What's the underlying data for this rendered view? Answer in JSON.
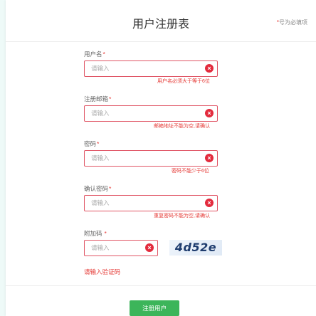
{
  "header": {
    "title": "用户注册表",
    "hint_star": "*",
    "hint": "号为必填项"
  },
  "fields": [
    {
      "label": "用户名",
      "star": "*",
      "placeholder": "请输入",
      "error": "用户名必须大于等于6位"
    },
    {
      "label": "注册邮箱",
      "star": "*",
      "placeholder": "请输入",
      "error": "邮箱地址不能为空,请确认"
    },
    {
      "label": "密码",
      "star": "*",
      "placeholder": "请输入",
      "error": "密码不能少于6位"
    },
    {
      "label": "确认密码",
      "star": "*",
      "placeholder": "请输入",
      "error": "重复密码不能为空,请确认"
    },
    {
      "label": "附加码",
      "star": "*",
      "placeholder": "请输入"
    }
  ],
  "captcha": {
    "text": "4d52e",
    "error": "请输入验证码"
  },
  "submit": {
    "label": "注册用户"
  },
  "colors": {
    "error": "#e53935",
    "primary": "#3cb55a",
    "border_error": "#e05565"
  },
  "icons": {
    "clear": "clear-circle-icon"
  }
}
